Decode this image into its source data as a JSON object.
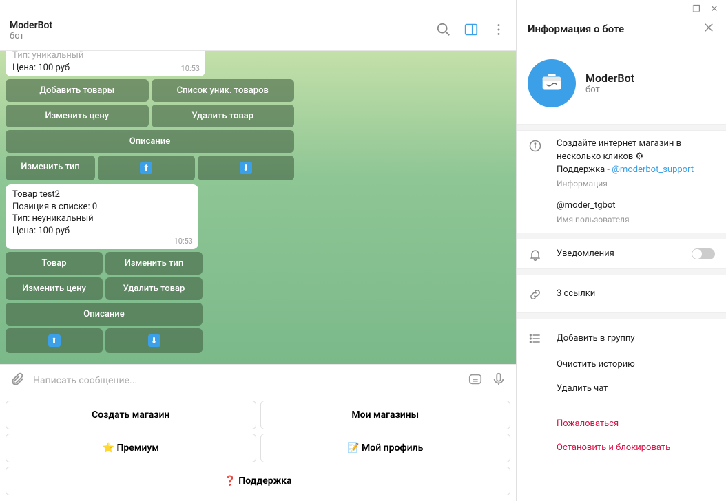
{
  "window": {
    "min": "_",
    "max": "❐",
    "close": "✕"
  },
  "chat_header": {
    "title": "ModerBot",
    "subtitle": "бот"
  },
  "side_panel": {
    "title": "Информация о боте",
    "bot_name": "ModerBot",
    "bot_type": "бот",
    "description_line1": "Создайте интернет магазин в несколько кликов ⚙",
    "description_line2_prefix": "Поддержка - ",
    "description_link": "@moderbot_support",
    "description_sub": "Информация",
    "username": "@moder_tgbot",
    "username_sub": "Имя пользователя",
    "notifications": "Уведомления",
    "links": "3 ссылки",
    "add_to_group": "Добавить в группу",
    "clear_history": "Очистить историю",
    "delete_chat": "Удалить чат",
    "report": "Пожаловаться",
    "stop_block": "Остановить и блокировать"
  },
  "msg1": {
    "line0": "Тип: уникальный",
    "line1": "Цена: 100 руб",
    "time": "10:53"
  },
  "inline1": {
    "r1c1": "Добавить товары",
    "r1c2": "Список уник. товаров",
    "r2c1": "Изменить цену",
    "r2c2": "Удалить товар",
    "r3": "Описание",
    "r4c1": "Изменить тип"
  },
  "msg2": {
    "l1": "Товар test2",
    "l2": "Позиция в списке: 0",
    "l3": "Тип: неуникальный",
    "l4": "Цена: 100 руб",
    "time": "10:53"
  },
  "inline2": {
    "r1c1": "Товар",
    "r1c2": "Изменить тип",
    "r2c1": "Изменить цену",
    "r2c2": "Удалить товар",
    "r3": "Описание"
  },
  "input": {
    "placeholder": "Написать сообщение..."
  },
  "keyboard": {
    "r1c1": "Создать магазин",
    "r1c2": "Мои магазины",
    "r2c1": "⭐ Премиум",
    "r2c2": "📝 Мой профиль",
    "r3": "❓ Поддержка"
  },
  "arrows": {
    "up": "⬆",
    "down": "⬇"
  }
}
